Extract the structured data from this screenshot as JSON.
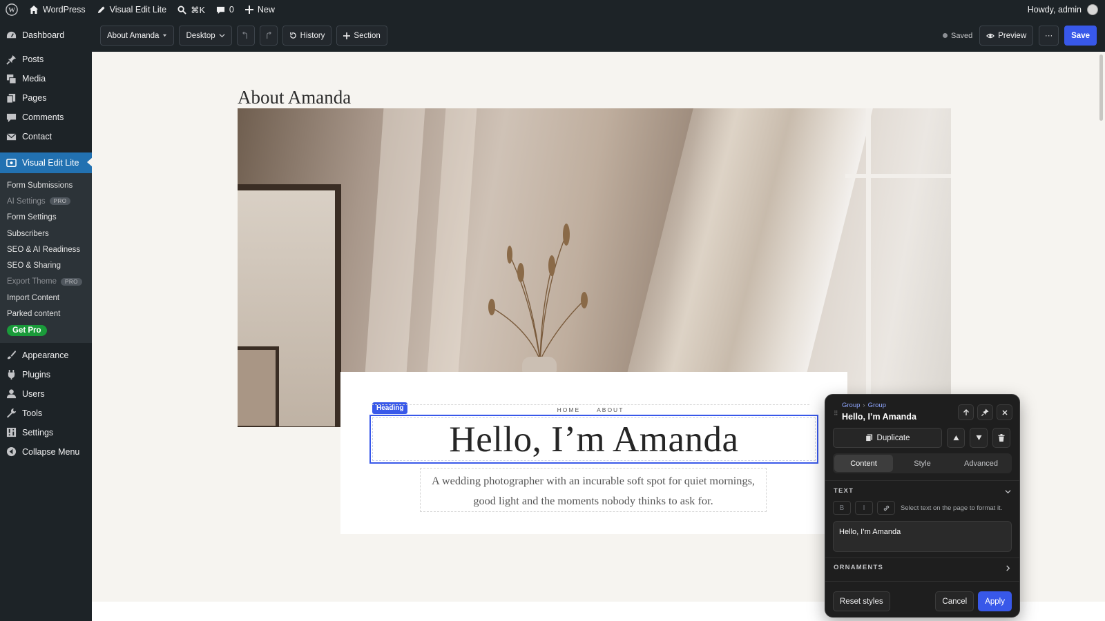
{
  "admin_bar": {
    "site_name": "WordPress",
    "plugin_name": "Visual Edit Lite",
    "search_shortcut": "⌘K",
    "comments_count": "0",
    "new_label": "New",
    "greeting": "Howdy, admin"
  },
  "sidebar": {
    "items_top": [
      {
        "label": "Dashboard",
        "icon": "dashboard-icon"
      },
      {
        "label": "Posts",
        "icon": "pin-icon"
      },
      {
        "label": "Media",
        "icon": "media-icon"
      },
      {
        "label": "Pages",
        "icon": "pages-icon"
      },
      {
        "label": "Comments",
        "icon": "comment-icon"
      },
      {
        "label": "Contact",
        "icon": "mail-icon"
      }
    ],
    "current": {
      "label": "Visual Edit Lite",
      "icon": "visual-edit-icon"
    },
    "submenu": [
      {
        "label": "Form Submissions"
      },
      {
        "label": "AI Settings",
        "badge": "PRO"
      },
      {
        "label": "Form Settings"
      },
      {
        "label": "Subscribers"
      },
      {
        "label": "SEO & AI Readiness"
      },
      {
        "label": "SEO & Sharing"
      },
      {
        "label": "Export Theme",
        "badge": "PRO"
      },
      {
        "label": "Import Content"
      },
      {
        "label": "Parked content"
      }
    ],
    "get_pro": "Get Pro",
    "items_bottom": [
      {
        "label": "Appearance",
        "icon": "brush-icon"
      },
      {
        "label": "Plugins",
        "icon": "plug-icon"
      },
      {
        "label": "Users",
        "icon": "user-icon"
      },
      {
        "label": "Tools",
        "icon": "wrench-icon"
      },
      {
        "label": "Settings",
        "icon": "settings-icon"
      },
      {
        "label": "Collapse Menu",
        "icon": "collapse-icon"
      }
    ]
  },
  "toolbar": {
    "page_select": "About Amanda",
    "device_select": "Desktop",
    "history_label": "History",
    "section_label": "Section",
    "status": "Saved",
    "preview_label": "Preview",
    "more_label": "···",
    "save_label": "Save"
  },
  "canvas": {
    "page_title": "About Amanda",
    "nav": [
      "HOME",
      "ABOUT"
    ],
    "selection_tag": "Heading",
    "heading": "Hello, I’m Amanda",
    "subtext": "A wedding photographer with an incurable soft spot for quiet mornings, good light and the moments nobody thinks to ask for."
  },
  "panel": {
    "breadcrumb": [
      "Group",
      "Group"
    ],
    "title": "Hello, I’m Amanda",
    "duplicate_label": "Duplicate",
    "tabs": [
      "Content",
      "Style",
      "Advanced"
    ],
    "active_tab": "Content",
    "text_section": "TEXT",
    "bold_label": "B",
    "italic_label": "I",
    "format_hint": "Select text on the page to format it.",
    "text_value": "Hello, I’m Amanda",
    "ornaments_section": "ORNAMENTS",
    "reset_label": "Reset styles",
    "cancel_label": "Cancel",
    "apply_label": "Apply"
  },
  "colors": {
    "accent": "#3858e9",
    "admin_bg": "#1d2327",
    "current_menu": "#2271b1",
    "canvas_bg": "#f6f4f0"
  }
}
